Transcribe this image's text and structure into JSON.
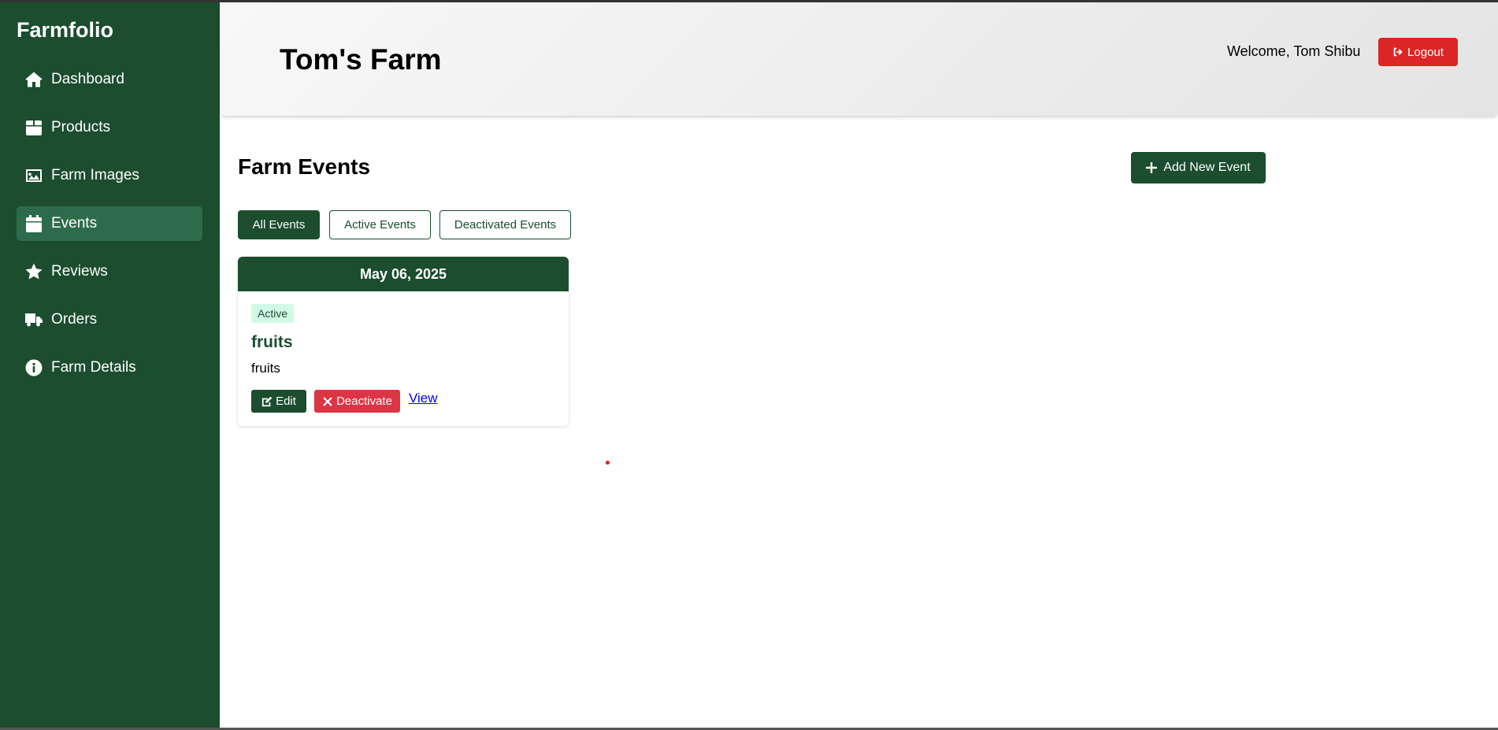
{
  "sidebar": {
    "brand": "Farmfolio",
    "items": [
      {
        "label": "Dashboard",
        "icon": "home-icon",
        "active": false
      },
      {
        "label": "Products",
        "icon": "box-icon",
        "active": false
      },
      {
        "label": "Farm Images",
        "icon": "image-icon",
        "active": false
      },
      {
        "label": "Events",
        "icon": "calendar-icon",
        "active": true
      },
      {
        "label": "Reviews",
        "icon": "star-icon",
        "active": false
      },
      {
        "label": "Orders",
        "icon": "truck-icon",
        "active": false
      },
      {
        "label": "Farm Details",
        "icon": "info-icon",
        "active": false
      }
    ]
  },
  "header": {
    "title": "Tom's Farm",
    "welcome": "Welcome, Tom Shibu",
    "logout_label": "Logout"
  },
  "main": {
    "heading": "Farm Events",
    "add_event_label": "Add New Event",
    "filters": [
      {
        "label": "All Events",
        "active": true
      },
      {
        "label": "Active Events",
        "active": false
      },
      {
        "label": "Deactivated Events",
        "active": false
      }
    ],
    "events": [
      {
        "date": "May 06, 2025",
        "status": "Active",
        "title": "fruits",
        "description": "fruits",
        "edit_label": "Edit",
        "deactivate_label": "Deactivate",
        "view_label": "View"
      }
    ]
  },
  "colors": {
    "primary": "#1b4d2e",
    "sidebar_active": "#2e6b4a",
    "danger": "#dc2626",
    "badge_bg": "#d1fae5",
    "link": "#0000ee"
  }
}
